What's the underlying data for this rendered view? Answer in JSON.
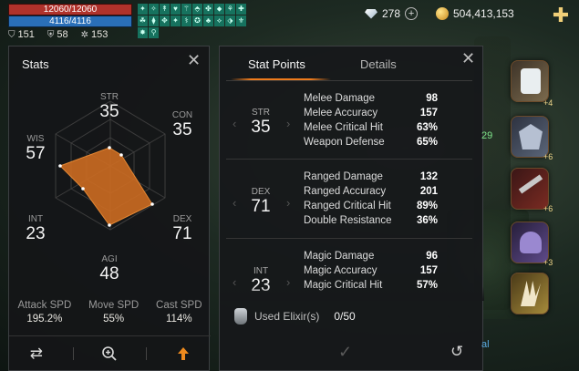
{
  "hud": {
    "hp": "12060/12060",
    "mp": "4116/4116",
    "buffs": [
      "✦",
      "✧",
      "↟",
      "♥",
      "⚚",
      "⬘",
      "✤",
      "⬥",
      "⚘",
      "✚",
      "☘",
      "⧫",
      "✥",
      "✦",
      "⚕",
      "✪",
      "♣",
      "⟡",
      "⬗",
      "⚜",
      "✸",
      "⚲"
    ],
    "stat1": "151",
    "stat2": "58",
    "stat3": "153"
  },
  "currency": {
    "gems": "278",
    "gold": "504,413,153"
  },
  "stats_panel": {
    "title": "Stats",
    "radar": {
      "STR": {
        "label": "STR",
        "value": "35"
      },
      "CON": {
        "label": "CON",
        "value": "35"
      },
      "DEX": {
        "label": "DEX",
        "value": "71"
      },
      "AGI": {
        "label": "AGI",
        "value": "48"
      },
      "INT": {
        "label": "INT",
        "value": "23"
      },
      "WIS": {
        "label": "WIS",
        "value": "57"
      }
    },
    "speeds": [
      {
        "label": "Attack SPD",
        "value": "195.2%"
      },
      {
        "label": "Move SPD",
        "value": "55%"
      },
      {
        "label": "Cast SPD",
        "value": "114%"
      }
    ]
  },
  "stat_points_panel": {
    "tabs": [
      "Stat Points",
      "Details"
    ],
    "groups": [
      {
        "abbr": "STR",
        "value": "35",
        "rows": [
          {
            "label": "Melee Damage",
            "value": "98"
          },
          {
            "label": "Melee Accuracy",
            "value": "157"
          },
          {
            "label": "Melee Critical Hit",
            "value": "63%"
          },
          {
            "label": "Weapon Defense",
            "value": "65%"
          }
        ]
      },
      {
        "abbr": "DEX",
        "value": "71",
        "rows": [
          {
            "label": "Ranged Damage",
            "value": "132"
          },
          {
            "label": "Ranged Accuracy",
            "value": "201"
          },
          {
            "label": "Ranged Critical Hit",
            "value": "89%"
          },
          {
            "label": "Double Resistance",
            "value": "36%"
          }
        ]
      },
      {
        "abbr": "INT",
        "value": "23",
        "rows": [
          {
            "label": "Magic Damage",
            "value": "96"
          },
          {
            "label": "Magic Accuracy",
            "value": "157"
          },
          {
            "label": "Magic Critical Hit",
            "value": "57%"
          }
        ]
      }
    ],
    "elixir": {
      "label": "Used Elixir(s)",
      "count": "0/50"
    }
  },
  "equipment": [
    {
      "icon": "robe-icon",
      "level": "+4"
    },
    {
      "icon": "armor-icon",
      "level": "+6"
    },
    {
      "icon": "crossbow-icon",
      "level": "+6"
    },
    {
      "icon": "helmet-icon",
      "level": "+3"
    },
    {
      "icon": "claw-icon",
      "level": ""
    }
  ],
  "bg_text": {
    "t1": "29",
    "t2": "al"
  }
}
